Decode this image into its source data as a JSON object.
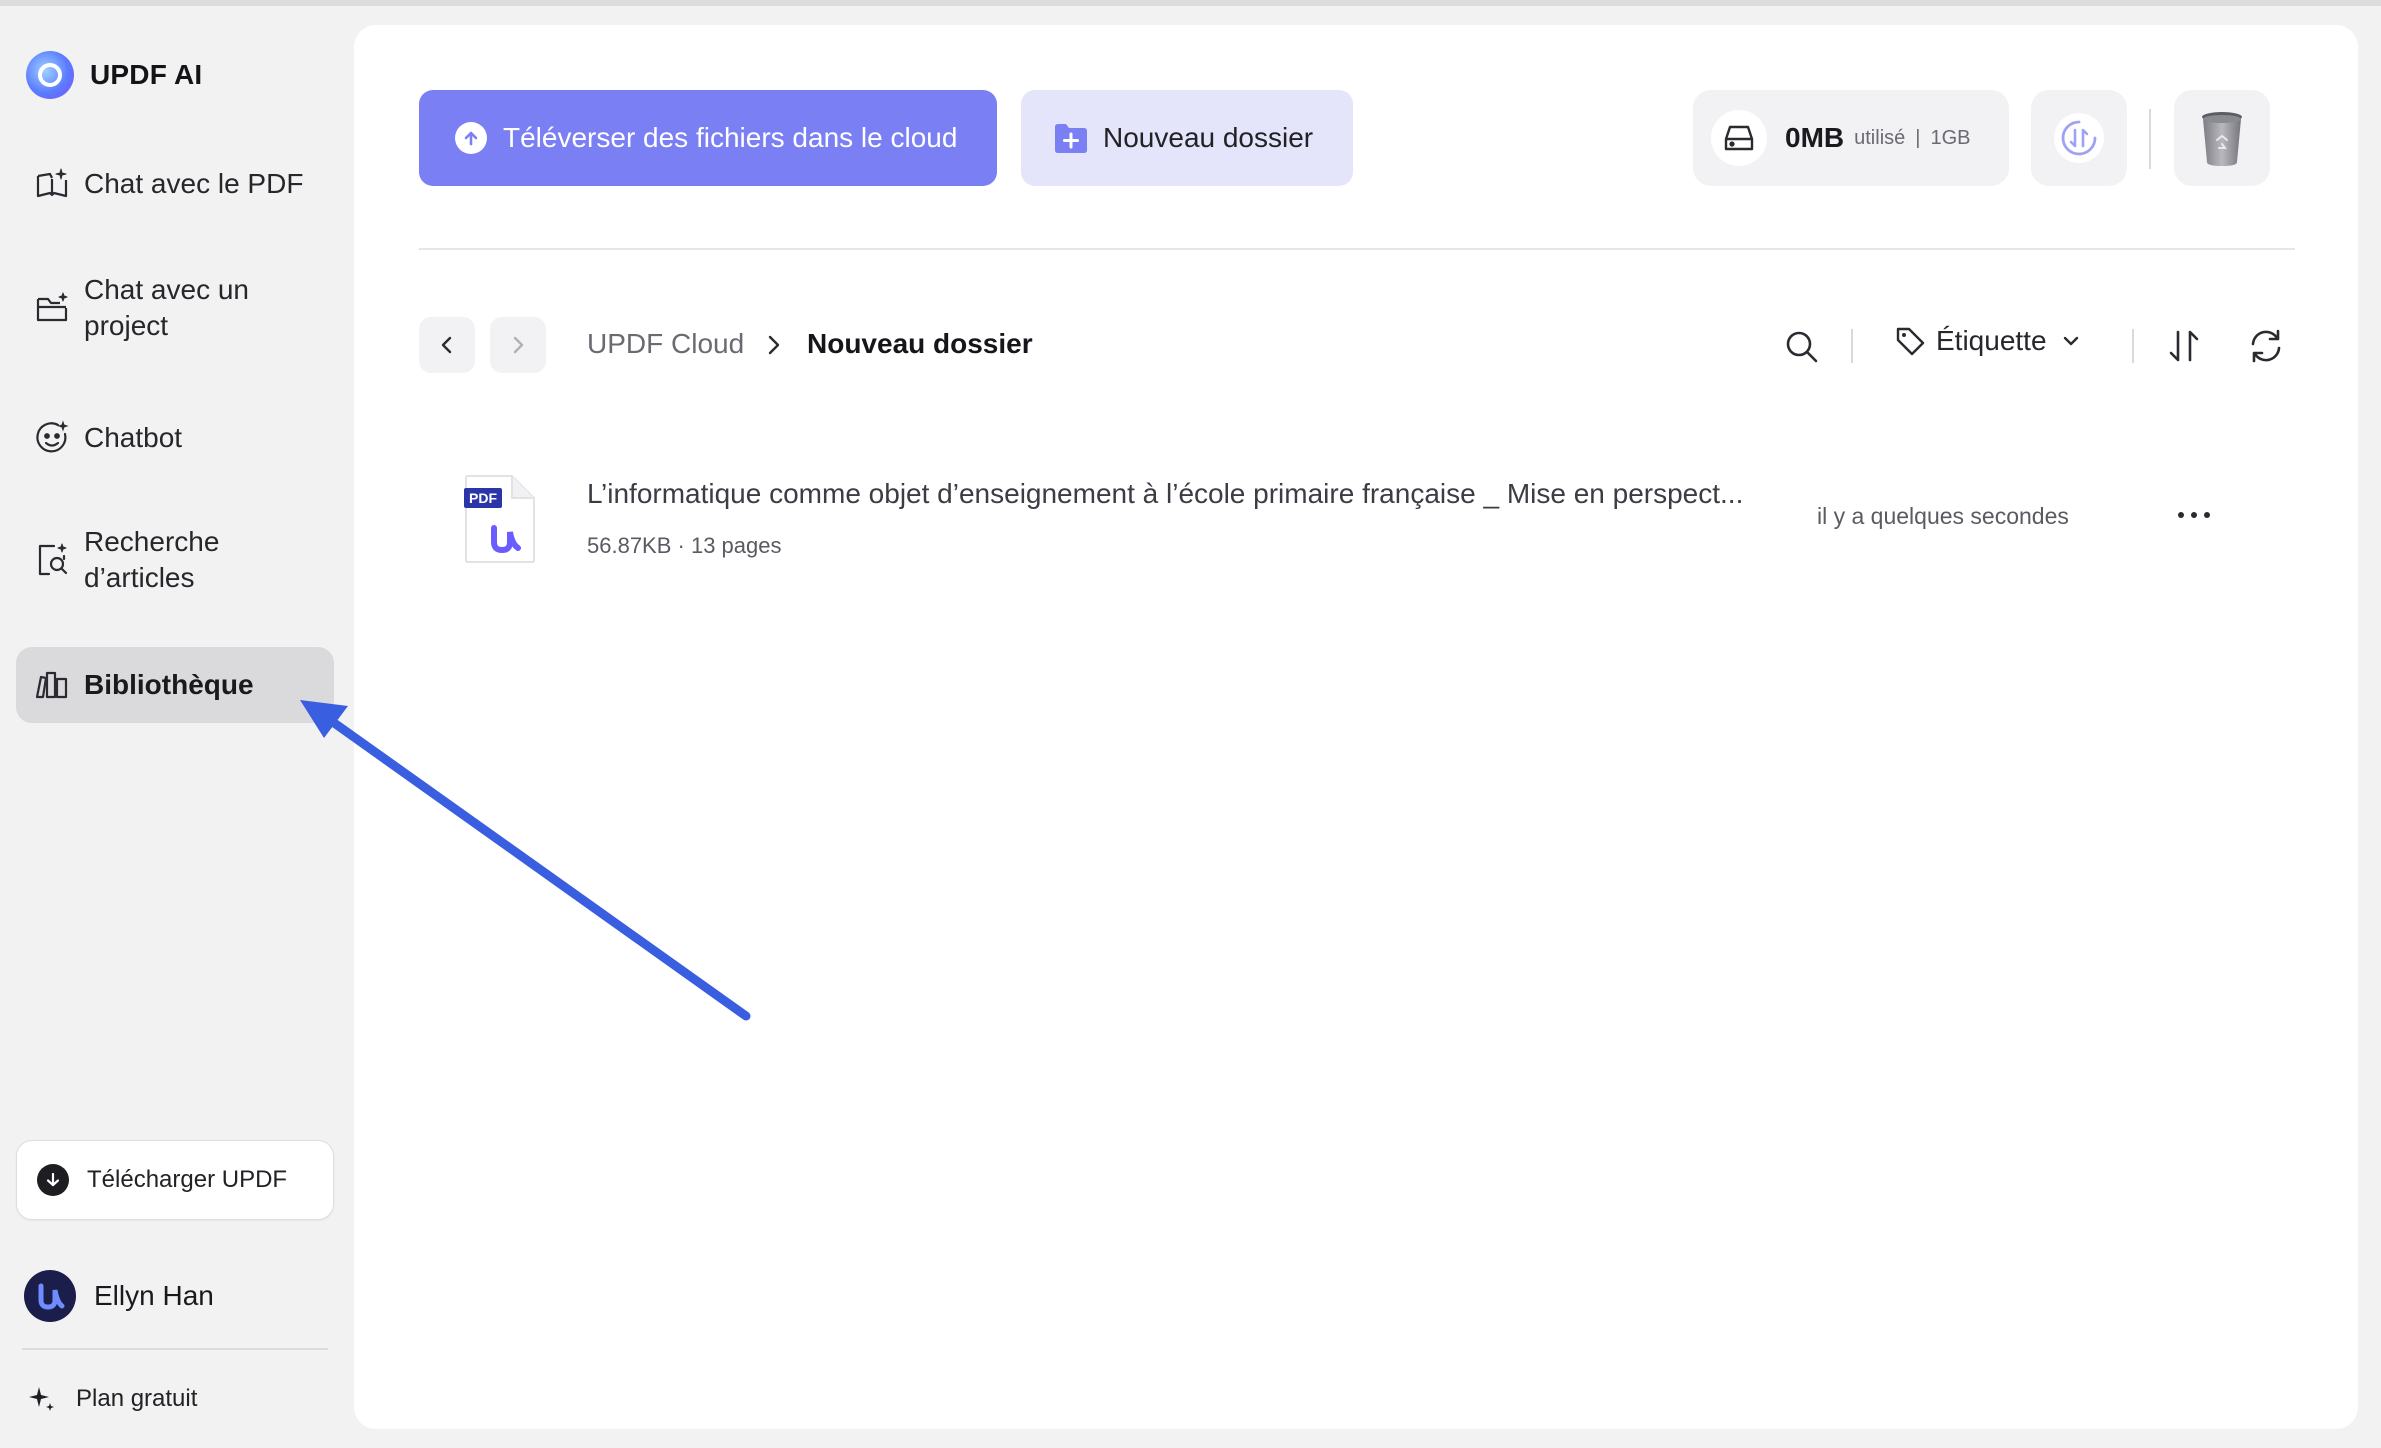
{
  "app": {
    "name": "UPDF AI"
  },
  "sidebar": {
    "items": [
      {
        "label": "Chat avec le PDF",
        "icon": "book-sparkle-icon"
      },
      {
        "label": "Chat avec un project",
        "line1": "Chat avec un",
        "line2": "project",
        "icon": "folder-sparkle-icon"
      },
      {
        "label": "Chatbot",
        "icon": "chatbot-face-icon"
      },
      {
        "label": "Recherche d’articles",
        "line1": "Recherche",
        "line2": "d’articles",
        "icon": "document-search-icon"
      },
      {
        "label": "Bibliothèque",
        "icon": "library-icon",
        "active": true
      }
    ],
    "download_label": "Télécharger UPDF",
    "user_name": "Ellyn Han",
    "plan_label": "Plan gratuit"
  },
  "toolbar": {
    "upload_label": "Téléverser des fichiers dans le cloud",
    "new_folder_label": "Nouveau dossier",
    "storage_used": "0MB",
    "storage_used_label": "utilisé",
    "storage_separator": "|",
    "storage_total": "1GB"
  },
  "breadcrumb": {
    "root": "UPDF Cloud",
    "current": "Nouveau dossier"
  },
  "filters": {
    "tag_label": "Étiquette"
  },
  "files": [
    {
      "name": "L’informatique comme objet d’enseignement à l’école primaire française _ Mise en perspect...",
      "meta": "56.87KB · 13 pages",
      "time": "il y a quelques secondes",
      "type_badge": "PDF"
    }
  ],
  "colors": {
    "accent": "#7b7ff4",
    "accent_light": "#e4e4fb",
    "sidebar_bg": "#f2f2f3",
    "active_item": "#dadadd",
    "annotation_arrow": "#3a5ee0"
  }
}
